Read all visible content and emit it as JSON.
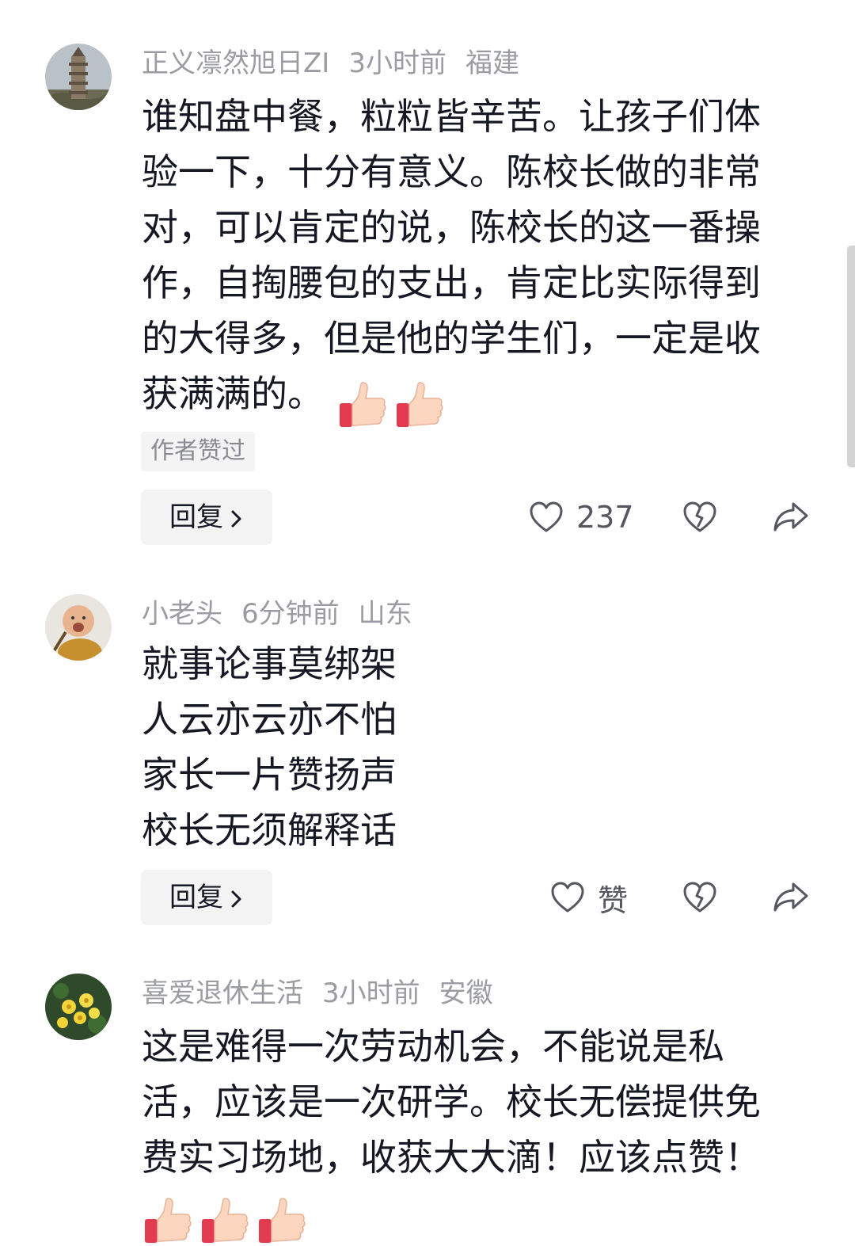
{
  "comments": [
    {
      "username": "正义凛然旭日ZI",
      "time": "3小时前",
      "location": "福建",
      "avatar_icon": "pagoda-avatar",
      "lines": [
        "谁知盘中餐，粒粒皆辛苦。让孩子们体",
        "验一下，十分有意义。陈校长做的非常",
        "对，可以肯定的说，陈校长的这一番操",
        "作，自掏腰包的支出，肯定比实际得到",
        "的大得多，但是他的学生们，一定是收",
        "获满满的。"
      ],
      "emoji": "thumbs-up-icon",
      "emoji_count": 2,
      "author_badge": "作者赞过",
      "reply_label": "回复",
      "like_label": "237"
    },
    {
      "username": "小老头",
      "time": "6分钟前",
      "location": "山东",
      "avatar_icon": "baby-monk-avatar",
      "lines": [
        "就事论事莫绑架",
        "人云亦云亦不怕",
        "家长一片赞扬声",
        "校长无须解释话"
      ],
      "reply_label": "回复",
      "like_label": "赞"
    },
    {
      "username": "喜爱退休生活",
      "time": "3小时前",
      "location": "安徽",
      "avatar_icon": "yellow-flowers-avatar",
      "lines": [
        "这是难得一次劳动机会，不能说是私",
        "活，应该是一次研学。校长无偿提供免",
        "费实习场地，收获大大滴！应该点赞！"
      ],
      "emoji": "thumbs-up-icon",
      "emoji_count": 3
    }
  ],
  "colors": {
    "meta_gray": "#9b9ca1",
    "text": "#161823",
    "button_bg": "#f3f3f4",
    "icon_gray": "#555760"
  }
}
